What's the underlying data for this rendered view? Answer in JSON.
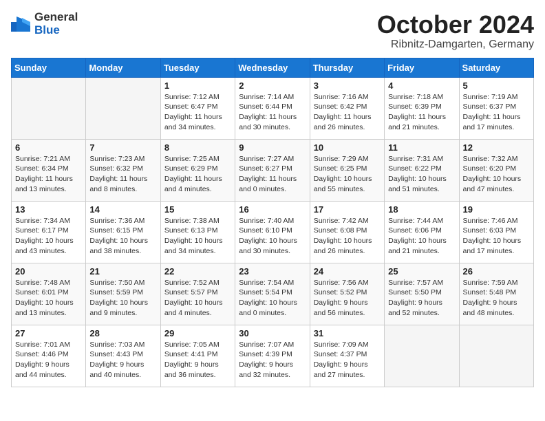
{
  "logo": {
    "general": "General",
    "blue": "Blue"
  },
  "title": {
    "month": "October 2024",
    "location": "Ribnitz-Damgarten, Germany"
  },
  "days_of_week": [
    "Sunday",
    "Monday",
    "Tuesday",
    "Wednesday",
    "Thursday",
    "Friday",
    "Saturday"
  ],
  "weeks": [
    [
      {
        "day": "",
        "sunrise": "",
        "sunset": "",
        "daylight": ""
      },
      {
        "day": "",
        "sunrise": "",
        "sunset": "",
        "daylight": ""
      },
      {
        "day": "1",
        "sunrise": "Sunrise: 7:12 AM",
        "sunset": "Sunset: 6:47 PM",
        "daylight": "Daylight: 11 hours and 34 minutes."
      },
      {
        "day": "2",
        "sunrise": "Sunrise: 7:14 AM",
        "sunset": "Sunset: 6:44 PM",
        "daylight": "Daylight: 11 hours and 30 minutes."
      },
      {
        "day": "3",
        "sunrise": "Sunrise: 7:16 AM",
        "sunset": "Sunset: 6:42 PM",
        "daylight": "Daylight: 11 hours and 26 minutes."
      },
      {
        "day": "4",
        "sunrise": "Sunrise: 7:18 AM",
        "sunset": "Sunset: 6:39 PM",
        "daylight": "Daylight: 11 hours and 21 minutes."
      },
      {
        "day": "5",
        "sunrise": "Sunrise: 7:19 AM",
        "sunset": "Sunset: 6:37 PM",
        "daylight": "Daylight: 11 hours and 17 minutes."
      }
    ],
    [
      {
        "day": "6",
        "sunrise": "Sunrise: 7:21 AM",
        "sunset": "Sunset: 6:34 PM",
        "daylight": "Daylight: 11 hours and 13 minutes."
      },
      {
        "day": "7",
        "sunrise": "Sunrise: 7:23 AM",
        "sunset": "Sunset: 6:32 PM",
        "daylight": "Daylight: 11 hours and 8 minutes."
      },
      {
        "day": "8",
        "sunrise": "Sunrise: 7:25 AM",
        "sunset": "Sunset: 6:29 PM",
        "daylight": "Daylight: 11 hours and 4 minutes."
      },
      {
        "day": "9",
        "sunrise": "Sunrise: 7:27 AM",
        "sunset": "Sunset: 6:27 PM",
        "daylight": "Daylight: 11 hours and 0 minutes."
      },
      {
        "day": "10",
        "sunrise": "Sunrise: 7:29 AM",
        "sunset": "Sunset: 6:25 PM",
        "daylight": "Daylight: 10 hours and 55 minutes."
      },
      {
        "day": "11",
        "sunrise": "Sunrise: 7:31 AM",
        "sunset": "Sunset: 6:22 PM",
        "daylight": "Daylight: 10 hours and 51 minutes."
      },
      {
        "day": "12",
        "sunrise": "Sunrise: 7:32 AM",
        "sunset": "Sunset: 6:20 PM",
        "daylight": "Daylight: 10 hours and 47 minutes."
      }
    ],
    [
      {
        "day": "13",
        "sunrise": "Sunrise: 7:34 AM",
        "sunset": "Sunset: 6:17 PM",
        "daylight": "Daylight: 10 hours and 43 minutes."
      },
      {
        "day": "14",
        "sunrise": "Sunrise: 7:36 AM",
        "sunset": "Sunset: 6:15 PM",
        "daylight": "Daylight: 10 hours and 38 minutes."
      },
      {
        "day": "15",
        "sunrise": "Sunrise: 7:38 AM",
        "sunset": "Sunset: 6:13 PM",
        "daylight": "Daylight: 10 hours and 34 minutes."
      },
      {
        "day": "16",
        "sunrise": "Sunrise: 7:40 AM",
        "sunset": "Sunset: 6:10 PM",
        "daylight": "Daylight: 10 hours and 30 minutes."
      },
      {
        "day": "17",
        "sunrise": "Sunrise: 7:42 AM",
        "sunset": "Sunset: 6:08 PM",
        "daylight": "Daylight: 10 hours and 26 minutes."
      },
      {
        "day": "18",
        "sunrise": "Sunrise: 7:44 AM",
        "sunset": "Sunset: 6:06 PM",
        "daylight": "Daylight: 10 hours and 21 minutes."
      },
      {
        "day": "19",
        "sunrise": "Sunrise: 7:46 AM",
        "sunset": "Sunset: 6:03 PM",
        "daylight": "Daylight: 10 hours and 17 minutes."
      }
    ],
    [
      {
        "day": "20",
        "sunrise": "Sunrise: 7:48 AM",
        "sunset": "Sunset: 6:01 PM",
        "daylight": "Daylight: 10 hours and 13 minutes."
      },
      {
        "day": "21",
        "sunrise": "Sunrise: 7:50 AM",
        "sunset": "Sunset: 5:59 PM",
        "daylight": "Daylight: 10 hours and 9 minutes."
      },
      {
        "day": "22",
        "sunrise": "Sunrise: 7:52 AM",
        "sunset": "Sunset: 5:57 PM",
        "daylight": "Daylight: 10 hours and 4 minutes."
      },
      {
        "day": "23",
        "sunrise": "Sunrise: 7:54 AM",
        "sunset": "Sunset: 5:54 PM",
        "daylight": "Daylight: 10 hours and 0 minutes."
      },
      {
        "day": "24",
        "sunrise": "Sunrise: 7:56 AM",
        "sunset": "Sunset: 5:52 PM",
        "daylight": "Daylight: 9 hours and 56 minutes."
      },
      {
        "day": "25",
        "sunrise": "Sunrise: 7:57 AM",
        "sunset": "Sunset: 5:50 PM",
        "daylight": "Daylight: 9 hours and 52 minutes."
      },
      {
        "day": "26",
        "sunrise": "Sunrise: 7:59 AM",
        "sunset": "Sunset: 5:48 PM",
        "daylight": "Daylight: 9 hours and 48 minutes."
      }
    ],
    [
      {
        "day": "27",
        "sunrise": "Sunrise: 7:01 AM",
        "sunset": "Sunset: 4:46 PM",
        "daylight": "Daylight: 9 hours and 44 minutes."
      },
      {
        "day": "28",
        "sunrise": "Sunrise: 7:03 AM",
        "sunset": "Sunset: 4:43 PM",
        "daylight": "Daylight: 9 hours and 40 minutes."
      },
      {
        "day": "29",
        "sunrise": "Sunrise: 7:05 AM",
        "sunset": "Sunset: 4:41 PM",
        "daylight": "Daylight: 9 hours and 36 minutes."
      },
      {
        "day": "30",
        "sunrise": "Sunrise: 7:07 AM",
        "sunset": "Sunset: 4:39 PM",
        "daylight": "Daylight: 9 hours and 32 minutes."
      },
      {
        "day": "31",
        "sunrise": "Sunrise: 7:09 AM",
        "sunset": "Sunset: 4:37 PM",
        "daylight": "Daylight: 9 hours and 27 minutes."
      },
      {
        "day": "",
        "sunrise": "",
        "sunset": "",
        "daylight": ""
      },
      {
        "day": "",
        "sunrise": "",
        "sunset": "",
        "daylight": ""
      }
    ]
  ]
}
